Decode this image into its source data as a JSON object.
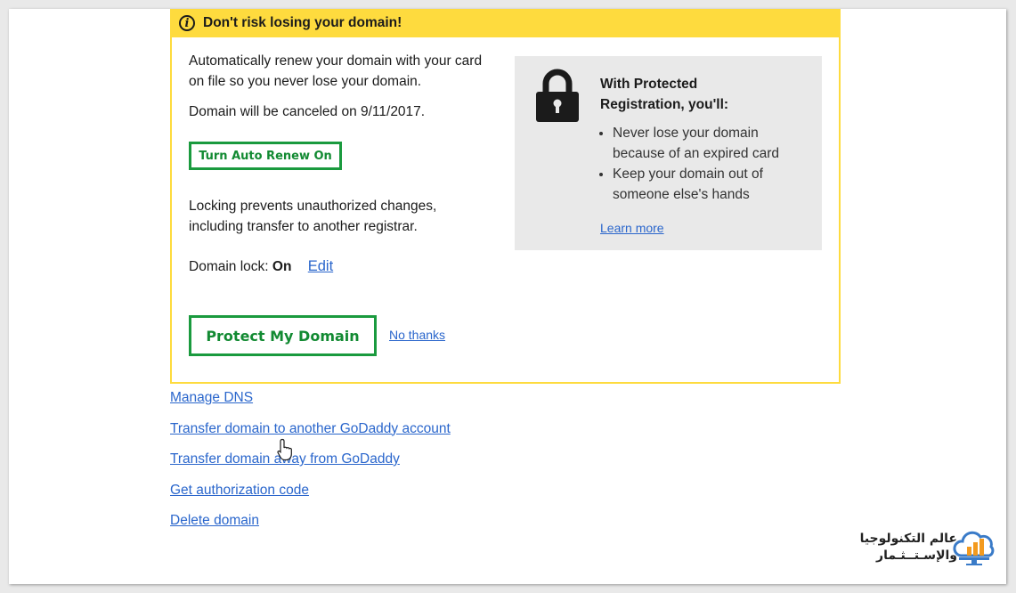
{
  "banner": {
    "title": "Don't risk losing your domain!",
    "auto_renew_text_1": "Automatically renew your domain with your card",
    "auto_renew_text_2": "on file so you never lose your domain.",
    "cancel_notice": "Domain will be canceled on 9/11/2017.",
    "auto_renew_button": "Turn Auto Renew On",
    "lock_text_1": "Locking prevents unauthorized changes,",
    "lock_text_2": "including transfer to another registrar.",
    "domain_lock_label": "Domain lock:",
    "domain_lock_value": "On",
    "edit_link": "Edit",
    "protect_button": "Protect My Domain",
    "no_thanks_link": "No thanks"
  },
  "protected_box": {
    "title_line_1": "With Protected",
    "title_line_2": "Registration, you'll:",
    "bullets": [
      {
        "line_1": "Never lose your domain",
        "line_2": "because of an expired card"
      },
      {
        "line_1": "Keep your domain out of",
        "line_2": "someone else's hands"
      }
    ],
    "learn_more": "Learn more"
  },
  "domain_actions": [
    "Manage DNS",
    "Transfer domain to another GoDaddy account",
    "Transfer domain away from GoDaddy",
    "Get authorization code",
    "Delete domain"
  ],
  "watermark": {
    "line_1": "عالم التكنولوجيا",
    "line_2": "والإسـتــثـمار"
  },
  "colors": {
    "banner_yellow": "#fedb3e",
    "button_green": "#1a9a3e",
    "link_blue": "#2a66cc",
    "side_box_gray": "#e9e9e9"
  },
  "icons": {
    "info": "info-icon",
    "lock": "lock-icon",
    "cursor": "hand-pointer-icon",
    "logo": "cloud-chart-logo"
  }
}
